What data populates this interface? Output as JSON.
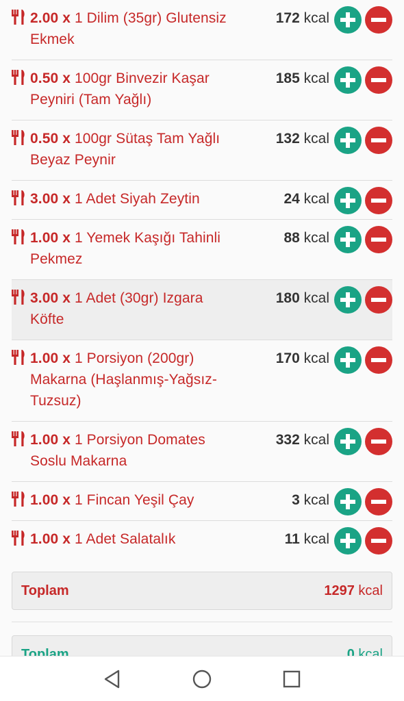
{
  "food_items": [
    {
      "qty": "2.00 x",
      "name": "1 Dilim (35gr) Glutensiz Ekmek",
      "kcal": "172",
      "unit": "kcal"
    },
    {
      "qty": "0.50 x",
      "name": "100gr Binvezir Kaşar Peyniri (Tam Yağlı)",
      "kcal": "185",
      "unit": "kcal"
    },
    {
      "qty": "0.50 x",
      "name": "100gr Sütaş Tam Yağlı Beyaz Peynir",
      "kcal": "132",
      "unit": "kcal"
    },
    {
      "qty": "3.00 x",
      "name": "1 Adet Siyah Zeytin",
      "kcal": "24",
      "unit": "kcal"
    },
    {
      "qty": "1.00 x",
      "name": "1 Yemek Kaşığı Tahinli Pekmez",
      "kcal": "88",
      "unit": "kcal"
    },
    {
      "qty": "3.00 x",
      "name": "1 Adet (30gr) Izgara Köfte",
      "kcal": "180",
      "unit": "kcal"
    },
    {
      "qty": "1.00 x",
      "name": "1 Porsiyon (200gr) Makarna (Haşlanmış-Yağsız-Tuzsuz)",
      "kcal": "170",
      "unit": "kcal"
    },
    {
      "qty": "1.00 x",
      "name": "1 Porsiyon Domates Soslu Makarna",
      "kcal": "332",
      "unit": "kcal"
    },
    {
      "qty": "1.00 x",
      "name": "1 Fincan Yeşil Çay",
      "kcal": "3",
      "unit": "kcal"
    },
    {
      "qty": "1.00 x",
      "name": "1 Adet Salatalık",
      "kcal": "11",
      "unit": "kcal"
    }
  ],
  "total": {
    "label": "Toplam",
    "value": "1297",
    "unit": "kcal"
  },
  "total_next": {
    "label": "Toplam",
    "value": "0",
    "unit": "kcal"
  },
  "icons": {
    "row_icon": "cutlery-icon",
    "add": "plus-icon",
    "remove": "minus-icon",
    "nav_back": "back-triangle-icon",
    "nav_home": "home-circle-icon",
    "nav_recents": "recents-square-icon"
  },
  "colors": {
    "food_red": "#c62828",
    "add_green": "#1aa385",
    "remove_red": "#d32f2f",
    "kcal_text": "#333333"
  }
}
